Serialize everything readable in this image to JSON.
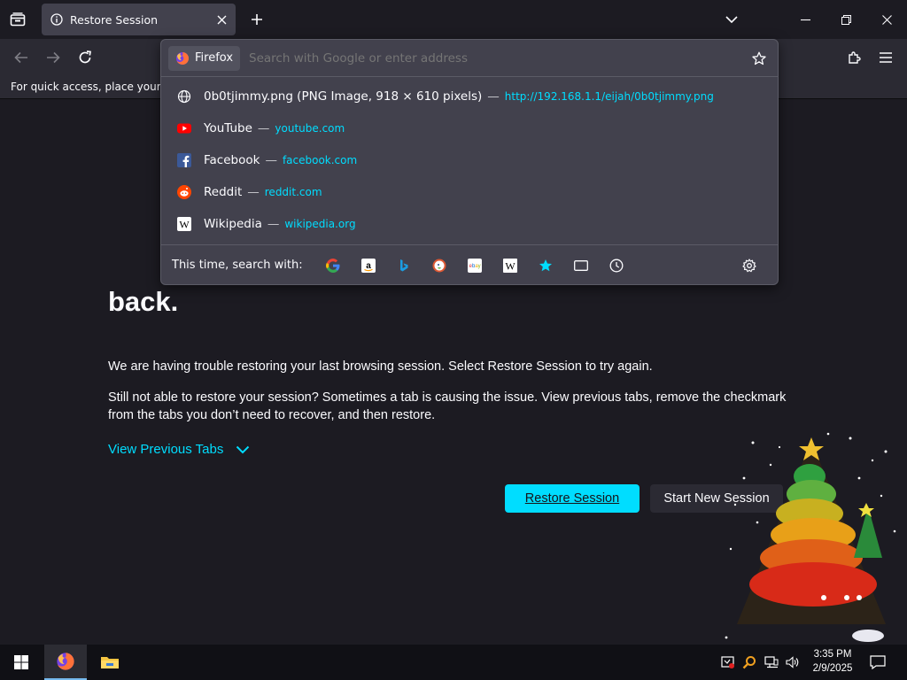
{
  "browser": {
    "tab": {
      "title": "Restore Session"
    },
    "bookmarks_bar_text": "For quick access, place your boo"
  },
  "urlbar": {
    "identity_label": "Firefox",
    "placeholder": "Search with Google or enter address",
    "results": [
      {
        "title": "0b0tjimmy.png (PNG Image, 918 × 610 pixels)",
        "separator": "—",
        "url": "http://192.168.1.1/eijah/0b0tjimmy.png",
        "icon": "globe-icon"
      },
      {
        "title": "YouTube",
        "separator": "—",
        "url": "youtube.com",
        "icon": "youtube-icon"
      },
      {
        "title": "Facebook",
        "separator": "—",
        "url": "facebook.com",
        "icon": "facebook-icon"
      },
      {
        "title": "Reddit",
        "separator": "—",
        "url": "reddit.com",
        "icon": "reddit-icon"
      },
      {
        "title": "Wikipedia",
        "separator": "—",
        "url": "wikipedia.org",
        "icon": "wikipedia-icon"
      }
    ],
    "oneoff_label": "This time, search with:",
    "engines": [
      "google-icon",
      "amazon-icon",
      "bing-icon",
      "duckduckgo-icon",
      "ebay-icon",
      "wikipedia-icon",
      "bookmarks-icon",
      "tabs-icon",
      "history-icon"
    ]
  },
  "page": {
    "heading": "Sorry. We're having trouble getting your pages back.",
    "heading_visible": "back.",
    "para1": "We are having trouble restoring your last browsing session. Select Restore Session to try again.",
    "para2": "Still not able to restore your session? Sometimes a tab is causing the issue. View previous tabs, remove the checkmark from the tabs you don’t need to recover, and then restore.",
    "view_previous_tabs": "View Previous Tabs",
    "restore_button": "Restore Session",
    "new_session_button": "Start New Session"
  },
  "taskbar": {
    "time": "3:35 PM",
    "date": "2/9/2025"
  },
  "colors": {
    "accent": "#00ddff",
    "background": "#1c1b22",
    "toolbar": "#2b2a33",
    "panel": "#42414d"
  }
}
